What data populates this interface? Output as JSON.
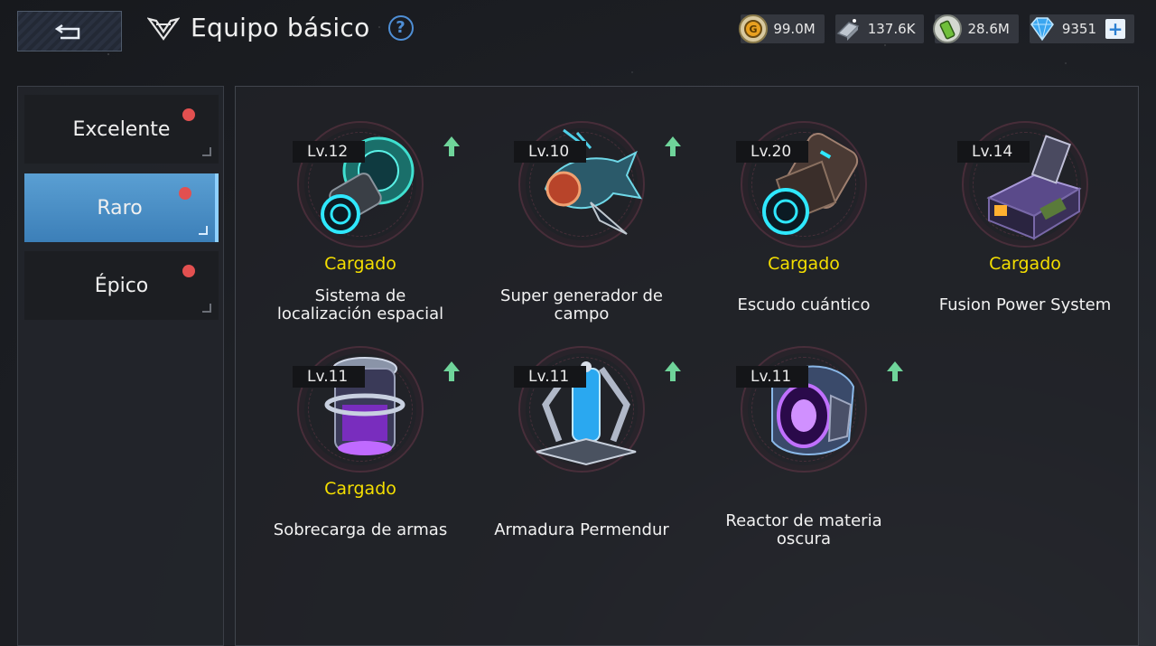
{
  "header": {
    "title": "Equipo básico",
    "help_label": "?"
  },
  "resources": [
    {
      "icon": "gold-coin-icon",
      "value": "99.0M"
    },
    {
      "icon": "alloy-ingot-icon",
      "value": "137.6K"
    },
    {
      "icon": "energy-battery-icon",
      "value": "28.6M"
    },
    {
      "icon": "diamond-icon",
      "value": "9351"
    }
  ],
  "plus_label": "+",
  "tabs": [
    {
      "label": "Excelente",
      "active": false,
      "badge": true
    },
    {
      "label": "Raro",
      "active": true,
      "badge": true
    },
    {
      "label": "Épico",
      "active": false,
      "badge": true
    }
  ],
  "items": [
    {
      "level": "Lv.12",
      "upgrade": true,
      "status": "Cargado",
      "name_line1": "Sistema de",
      "name_line2": "localización espacial",
      "icon": "spatial-locator-icon"
    },
    {
      "level": "Lv.10",
      "upgrade": true,
      "status": "",
      "name_line1": "Super generador de",
      "name_line2": "campo",
      "icon": "field-generator-icon"
    },
    {
      "level": "Lv.20",
      "upgrade": false,
      "status": "Cargado",
      "name_line1": "Escudo cuántico",
      "name_line2": "",
      "icon": "quantum-shield-icon"
    },
    {
      "level": "Lv.14",
      "upgrade": false,
      "status": "Cargado",
      "name_line1": "Fusion Power System",
      "name_line2": "",
      "icon": "fusion-power-icon"
    },
    {
      "level": "Lv.11",
      "upgrade": true,
      "status": "Cargado",
      "name_line1": "Sobrecarga de armas",
      "name_line2": "",
      "icon": "weapon-overload-icon"
    },
    {
      "level": "Lv.11",
      "upgrade": true,
      "status": "",
      "name_line1": "Armadura Permendur",
      "name_line2": "",
      "icon": "permendur-armor-icon"
    },
    {
      "level": "Lv.11",
      "upgrade": true,
      "status": "",
      "name_line1": "Reactor de materia",
      "name_line2": "oscura",
      "icon": "dark-matter-reactor-icon"
    }
  ],
  "colors": {
    "accent": "#3c7fb8",
    "status_yellow": "#f5df00",
    "badge_red": "#e25050",
    "upgrade_green": "#6fd49a"
  }
}
